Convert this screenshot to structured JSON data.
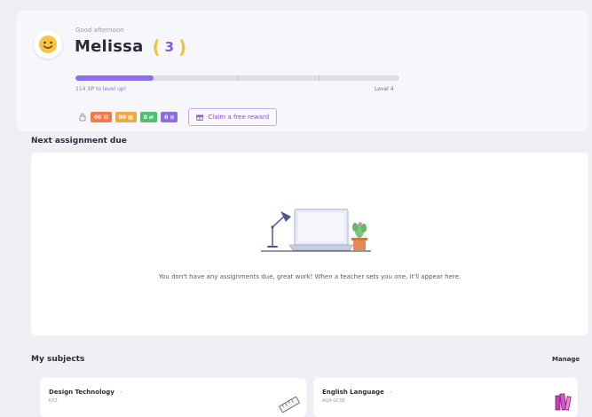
{
  "header": {
    "greeting": "Good afternoon",
    "name": "Melissa",
    "level_number": "3",
    "xp_text": "114 XP to level up!",
    "next_level": "Level 4",
    "xp_progress": 0.24,
    "avatar_icon": "smiley-face-icon"
  },
  "badges": [
    {
      "label": "00 ⚄",
      "color": "#f27a4a"
    },
    {
      "label": "00 ▦",
      "color": "#f0a840"
    },
    {
      "label": "0 ⇄",
      "color": "#4fbf70"
    },
    {
      "label": "0 ⊘",
      "color": "#8d6ae8"
    }
  ],
  "claim_button": {
    "label": "Claim a free reward",
    "icon": "gift-icon"
  },
  "assignments": {
    "title": "Next assignment due",
    "empty_message": "You don't have any assignments due, great work! When a teacher sets you one, it'll appear here."
  },
  "subjects": {
    "title": "My subjects",
    "manage_label": "Manage",
    "items": [
      {
        "name": "Design Technology",
        "level": "KS3",
        "icon": "ruler-icon"
      },
      {
        "name": "English Language",
        "level": "AQA GCSE",
        "icon": "books-icon"
      }
    ]
  }
}
